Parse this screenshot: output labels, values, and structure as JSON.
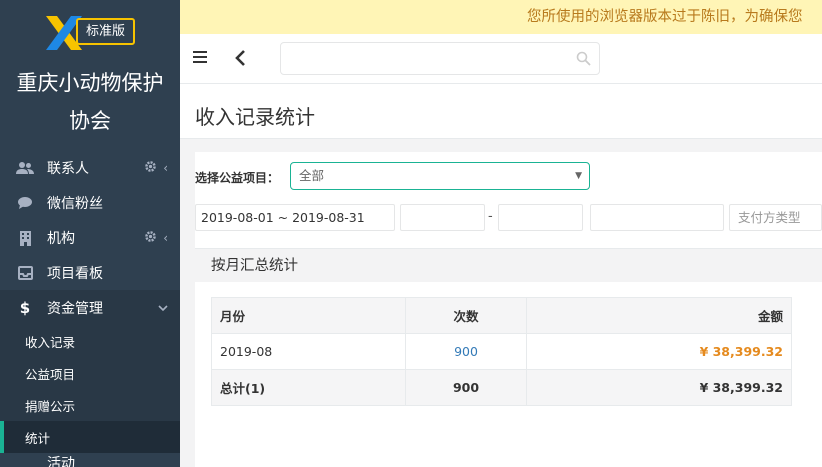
{
  "sidebar": {
    "edition": "标准版",
    "org_name_line1": "重庆小动物保护",
    "org_name_line2": "协会",
    "items": [
      {
        "label": "联系人"
      },
      {
        "label": "微信粉丝"
      },
      {
        "label": "机构"
      },
      {
        "label": "项目看板"
      },
      {
        "label": "资金管理"
      }
    ],
    "sub_items": [
      {
        "label": "收入记录"
      },
      {
        "label": "公益项目"
      },
      {
        "label": "捐赠公示"
      },
      {
        "label": "统计"
      }
    ],
    "next_item_partial": "活动"
  },
  "notice": {
    "text": "您所使用的浏览器版本过于陈旧，为确保您"
  },
  "header": {
    "search_placeholder": ""
  },
  "page": {
    "title": "收入记录统计"
  },
  "filters": {
    "project_label": "选择公益项目：",
    "project_value": "全部",
    "date_range": "2019-08-01 ~ 2019-08-31",
    "dash": "-",
    "pay_type_placeholder": "支付方类型"
  },
  "panel": {
    "title": "按月汇总统计",
    "headers": {
      "month": "月份",
      "count": "次数",
      "amount": "金额"
    },
    "rows": [
      {
        "month": "2019-08",
        "count": "900",
        "amount": "¥ 38,399.32"
      }
    ],
    "total": {
      "month": "总计(1)",
      "count": "900",
      "amount": "¥ 38,399.32"
    }
  },
  "colors": {
    "sidebar_bg": "#2f4050",
    "accent_green": "#1ab394",
    "notice_bg": "#fff5b6",
    "notice_text": "#b87a1d",
    "amount_orange": "#e58a1e",
    "link_blue": "#337ab7"
  }
}
